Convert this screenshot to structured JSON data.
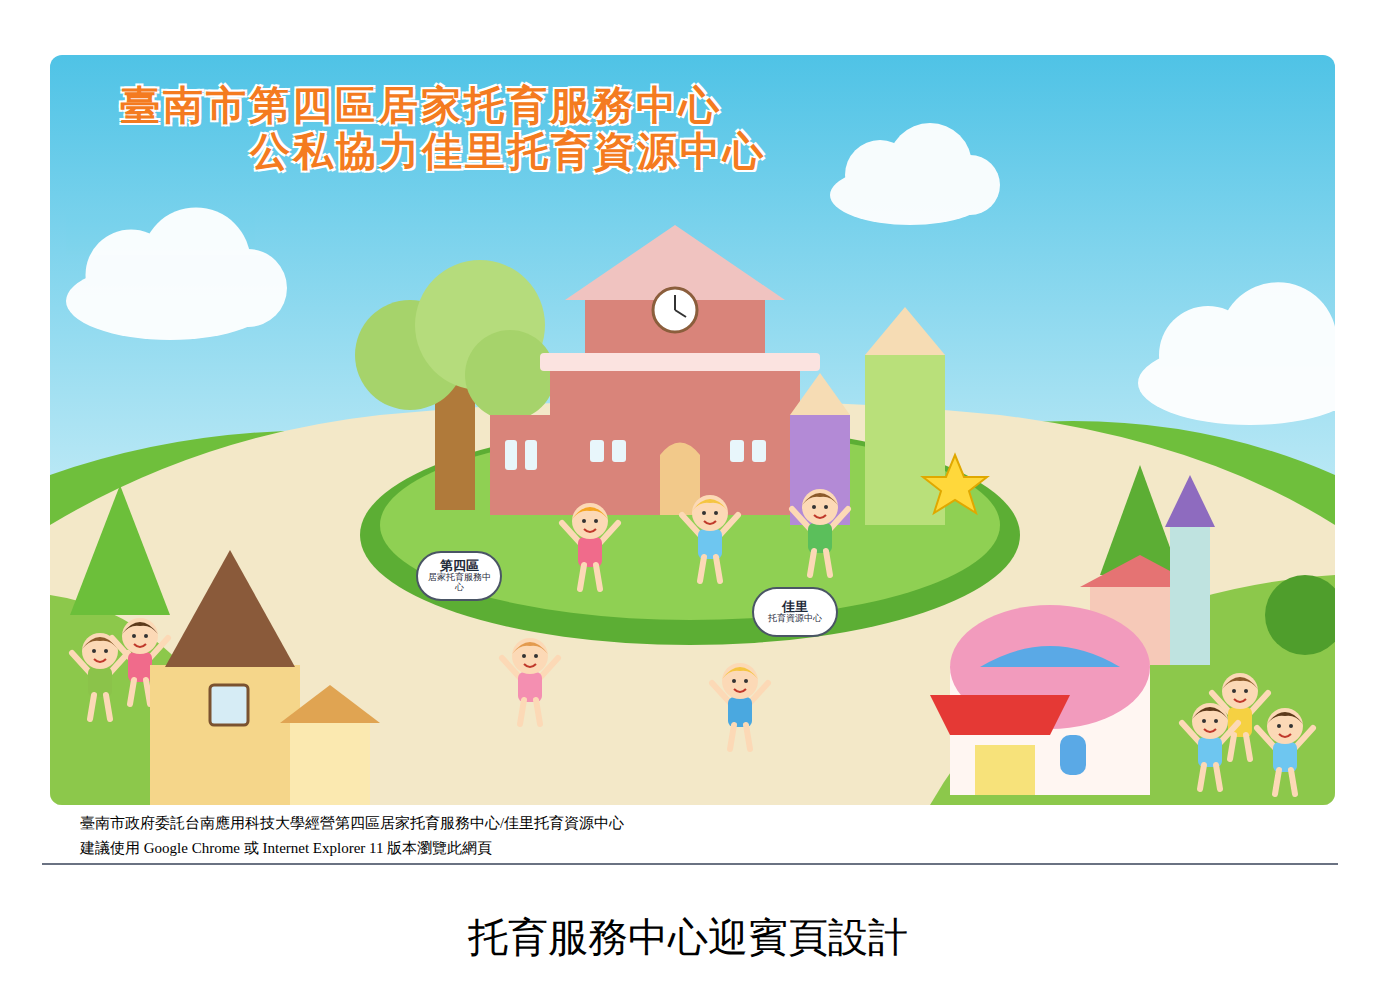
{
  "page": {
    "title_lines": [
      "臺南市第四區居家托育服務中心",
      "公私協力佳里托育資源中心"
    ],
    "bubbles": [
      {
        "line1": "第四區",
        "line2": "居家托育服務中心"
      },
      {
        "line1": "佳里",
        "line2": "托育資源中心"
      }
    ],
    "footer": [
      "臺南市政府委託台南應用科技大學經營第四區居家托育服務中心/佳里托育資源中心",
      "建議使用 Google Chrome 或 Internet Explorer 11 版本瀏覽此網頁"
    ],
    "caption": "托育服務中心迎賓頁設計"
  }
}
